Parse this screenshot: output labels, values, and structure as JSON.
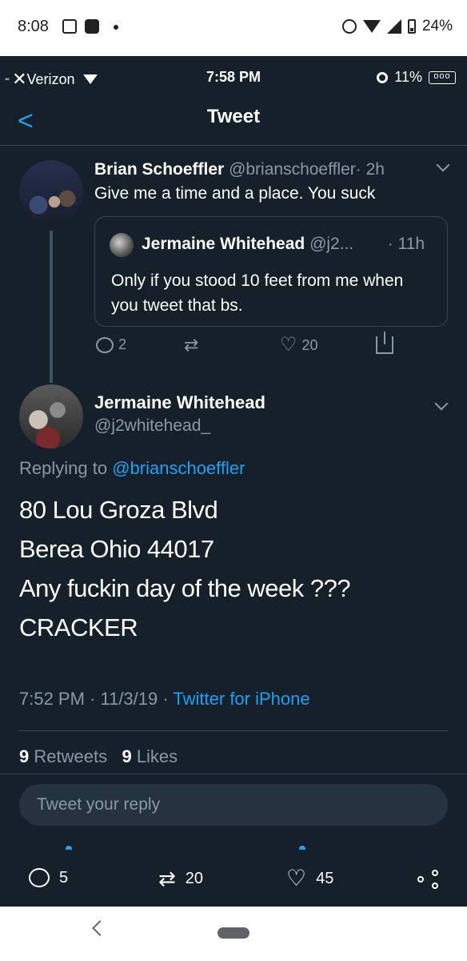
{
  "android_status": {
    "time": "8:08",
    "battery": "24%"
  },
  "ios_status": {
    "carrier": "Verizon",
    "time": "7:58 PM",
    "battery": "11%"
  },
  "header": {
    "title": "Tweet",
    "back_glyph": "<"
  },
  "parent_tweet": {
    "name": "Brian Schoeffler",
    "handle": "@brianschoeffler",
    "time": "· 2h",
    "text": "Give me a time and a place. You suck",
    "quote": {
      "name": "Jermaine Whitehead",
      "handle": "@j2...",
      "time": "· 11h",
      "text": "Only if you stood 10 feet from me when you tweet that bs."
    },
    "actions": {
      "replies": "2",
      "likes": "20"
    }
  },
  "main_tweet": {
    "name": "Jermaine Whitehead",
    "handle": "@j2whitehead_",
    "replying_prefix": "Replying to",
    "replying_to": "@brianschoeffler",
    "lines": [
      "80 Lou Groza Blvd",
      "Berea Ohio 44017",
      "Any fuckin day of the week ???",
      "CRACKER"
    ],
    "timestamp": "7:52 PM · 11/3/19 ·",
    "source": "Twitter for iPhone",
    "retweets_count": "9",
    "retweets_label": "Retweets",
    "likes_count": "9",
    "likes_label": "Likes"
  },
  "reply_box": {
    "placeholder": "Tweet your reply"
  },
  "bottom_actions": {
    "replies": "5",
    "retweets": "20",
    "likes": "45"
  },
  "colors": {
    "background": "#15202b",
    "accent": "#1da1f2",
    "muted": "#8899a6",
    "border": "#38444d"
  }
}
